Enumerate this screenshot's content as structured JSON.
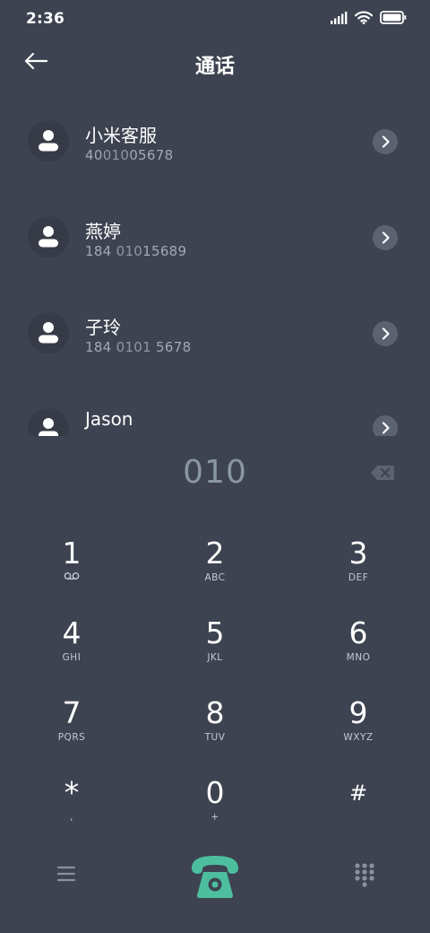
{
  "status_bar": {
    "time": "2:36",
    "icons": [
      "signal-icon",
      "wifi-icon",
      "battery-icon"
    ]
  },
  "header": {
    "title": "通话",
    "back_icon": "back-arrow-icon"
  },
  "contacts": [
    {
      "name": "小米客服",
      "number_parts": [
        {
          "text": "40",
          "highlight": false
        },
        {
          "text": "010",
          "highlight": true
        },
        {
          "text": "05678",
          "highlight": false
        }
      ]
    },
    {
      "name": "燕婷",
      "number_parts": [
        {
          "text": "184 ",
          "highlight": false
        },
        {
          "text": "010",
          "highlight": true
        },
        {
          "text": "15689",
          "highlight": false
        }
      ]
    },
    {
      "name": "子玲",
      "number_parts": [
        {
          "text": "184 ",
          "highlight": false
        },
        {
          "text": "0101",
          "highlight": true
        },
        {
          "text": " 5678",
          "highlight": false
        }
      ]
    },
    {
      "name": "Jason",
      "number_parts": []
    }
  ],
  "dial": {
    "number": "010"
  },
  "keypad": {
    "keys": [
      {
        "digit": "1",
        "letters": "",
        "sub_icon": "voicemail-icon"
      },
      {
        "digit": "2",
        "letters": "ABC"
      },
      {
        "digit": "3",
        "letters": "DEF"
      },
      {
        "digit": "4",
        "letters": "GHI"
      },
      {
        "digit": "5",
        "letters": "JKL"
      },
      {
        "digit": "6",
        "letters": "MNO"
      },
      {
        "digit": "7",
        "letters": "PQRS"
      },
      {
        "digit": "8",
        "letters": "TUV"
      },
      {
        "digit": "9",
        "letters": "WXYZ"
      },
      {
        "digit": "*",
        "letters": ","
      },
      {
        "digit": "0",
        "letters": "+"
      },
      {
        "digit": "#",
        "letters": ""
      }
    ]
  },
  "bottom_bar": {
    "menu_icon": "menu-icon",
    "call_icon": "phone-icon",
    "keypad_icon": "dialpad-icon"
  },
  "colors": {
    "background": "#3d4350",
    "call_button": "#4dbf9e",
    "highlight_digits": "#8e98a7",
    "secondary_text": "#a3aab5"
  }
}
